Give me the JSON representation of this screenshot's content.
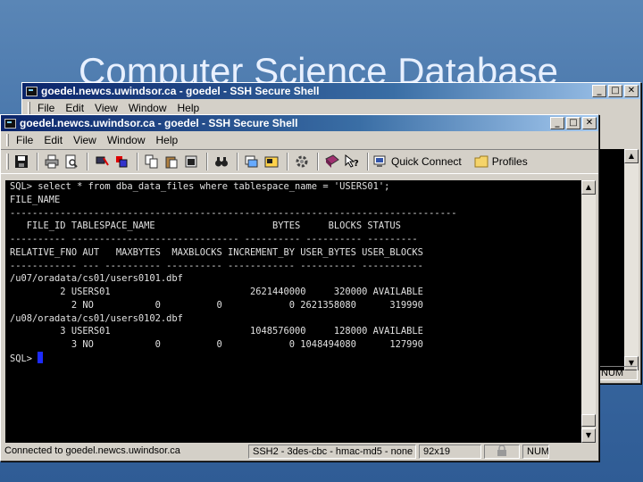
{
  "slide": {
    "title": "Computer Science Database"
  },
  "back_window": {
    "title": "goedel.newcs.uwindsor.ca - goedel - SSH Secure Shell",
    "menu": [
      "File",
      "Edit",
      "View",
      "Window",
      "Help"
    ],
    "status_num": "NUM"
  },
  "window": {
    "title": "goedel.newcs.uwindsor.ca - goedel - SSH Secure Shell",
    "caption_buttons": {
      "minimize": "_",
      "maximize": "□",
      "close": "✕"
    },
    "menu": [
      "File",
      "Edit",
      "View",
      "Window",
      "Help"
    ],
    "toolbar": {
      "quick_connect": "Quick Connect",
      "profiles": "Profiles",
      "icons": [
        "save-icon",
        "print-icon",
        "print-preview-icon",
        "disconnect-icon",
        "settings-icon",
        "copy-icon",
        "paste-icon",
        "paste-alt-icon",
        "find-icon",
        "file-transfer-icon",
        "new-terminal-icon",
        "key-settings-icon",
        "help-book-icon",
        "context-help-icon"
      ]
    },
    "terminal_lines": [
      "",
      "SQL> select * from dba_data_files where tablespace_name = 'USERS01';",
      "",
      "FILE_NAME",
      "--------------------------------------------------------------------------------",
      "   FILE_ID TABLESPACE_NAME                     BYTES     BLOCKS STATUS",
      "---------- ------------------------------ ---------- ---------- ---------",
      "RELATIVE_FNO AUT   MAXBYTES  MAXBLOCKS INCREMENT_BY USER_BYTES USER_BLOCKS",
      "------------ --- ---------- ---------- ------------ ---------- -----------",
      "/u07/oradata/cs01/users0101.dbf",
      "         2 USERS01                         2621440000     320000 AVAILABLE",
      "           2 NO           0          0            0 2621358080      319990",
      "",
      "/u08/oradata/cs01/users0102.dbf",
      "         3 USERS01                         1048576000     128000 AVAILABLE",
      "           3 NO           0          0            0 1048494080      127990",
      "",
      "",
      "SQL> "
    ],
    "status": {
      "connection": "Connected to goedel.newcs.uwindsor.ca",
      "cipher": "SSH2 - 3des-cbc - hmac-md5 - none",
      "size": "92x19",
      "num": "NUM"
    }
  },
  "colors": {
    "titlebar": "#0a246a",
    "terminal_bg": "#000000",
    "terminal_fg": "#e0e0e0",
    "cursor": "#1d2bff",
    "desktop": "#3f6ea6"
  }
}
